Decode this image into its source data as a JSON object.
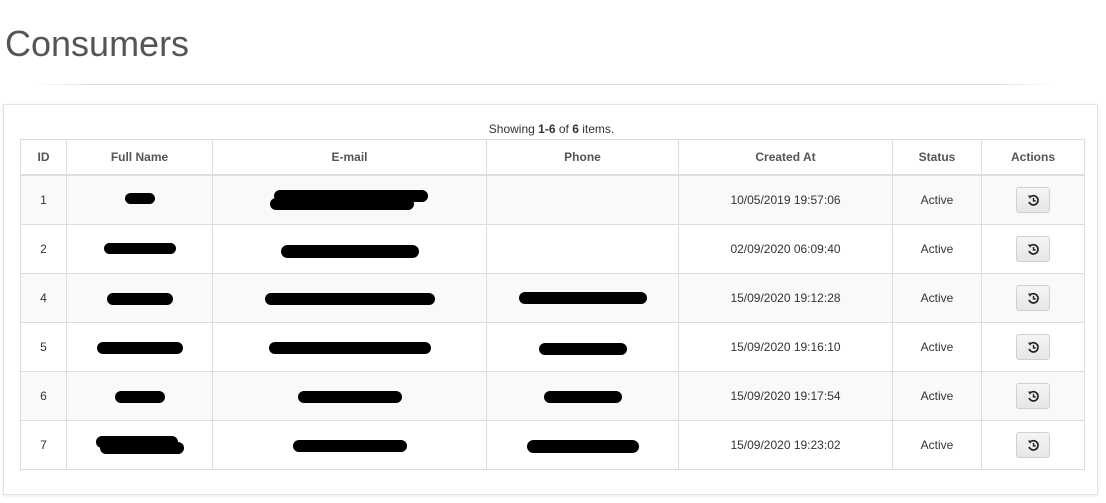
{
  "page": {
    "title": "Consumers"
  },
  "summary": {
    "prefix": "Showing ",
    "range": "1-6",
    "of": " of ",
    "total": "6",
    "suffix": " items."
  },
  "table": {
    "columns": [
      "ID",
      "Full Name",
      "E-mail",
      "Phone",
      "Created At",
      "Status",
      "Actions"
    ],
    "rows": [
      {
        "id": "1",
        "created_at": "10/05/2019 19:57:06",
        "status": "Active"
      },
      {
        "id": "2",
        "created_at": "02/09/2020 06:09:40",
        "status": "Active"
      },
      {
        "id": "4",
        "created_at": "15/09/2020 19:12:28",
        "status": "Active"
      },
      {
        "id": "5",
        "created_at": "15/09/2020 19:16:10",
        "status": "Active"
      },
      {
        "id": "6",
        "created_at": "15/09/2020 19:17:54",
        "status": "Active"
      },
      {
        "id": "7",
        "created_at": "15/09/2020 19:23:02",
        "status": "Active"
      }
    ],
    "action_icon": "restore-icon",
    "redaction_color": "#000000"
  }
}
